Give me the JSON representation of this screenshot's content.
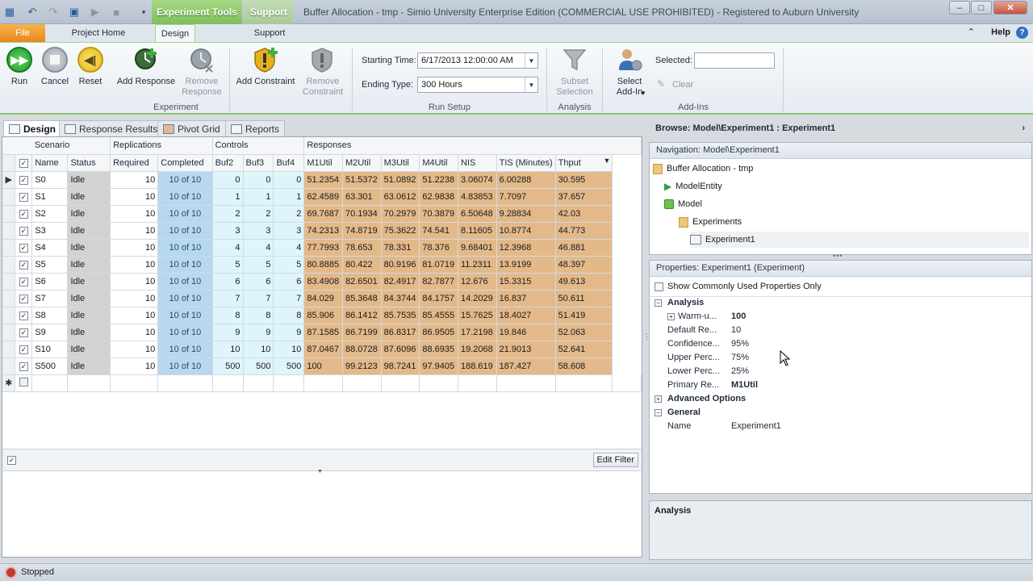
{
  "window": {
    "title": "Buffer Allocation - tmp - Simio University Enterprise Edition (COMMERCIAL USE PROHIBITED) - Registered to Auburn University",
    "context_tabs": [
      "Experiment Tools",
      "Support"
    ]
  },
  "ribbon_tabs": {
    "file": "File",
    "project_home": "Project Home",
    "design": "Design",
    "support": "Support",
    "help": "Help"
  },
  "ribbon": {
    "experiment": {
      "label": "Experiment",
      "run": "Run",
      "cancel": "Cancel",
      "reset": "Reset",
      "add_response": "Add Response",
      "remove_response": "Remove Response",
      "add_constraint": "Add Constraint",
      "remove_constraint": "Remove Constraint"
    },
    "run_setup": {
      "label": "Run Setup",
      "starting_time_label": "Starting Time:",
      "starting_time_value": "6/17/2013 12:00:00 AM",
      "ending_type_label": "Ending Type:",
      "ending_type_value": "300 Hours"
    },
    "analysis": {
      "label": "Analysis",
      "subset_selection": "Subset Selection"
    },
    "addins": {
      "label": "Add-Ins",
      "select_addin": "Select Add-In",
      "selected_label": "Selected:",
      "selected_value": "",
      "clear": "Clear"
    }
  },
  "doc_tabs": [
    "Design",
    "Response Results",
    "Pivot Grid",
    "Reports"
  ],
  "grid": {
    "bands": [
      "Scenario",
      "Replications",
      "Controls",
      "Responses"
    ],
    "columns": [
      "Name",
      "Status",
      "Required",
      "Completed",
      "Buf2",
      "Buf3",
      "Buf4",
      "M1Util",
      "M2Util",
      "M3Util",
      "M4Util",
      "NIS",
      "TIS (Minutes)",
      "Thput"
    ],
    "rows": [
      [
        "S0",
        "Idle",
        "10",
        "10 of 10",
        "0",
        "0",
        "0",
        "51.2354",
        "51.5372",
        "51.0892",
        "51.2238",
        "3.06074",
        "6.00288",
        "30.595"
      ],
      [
        "S1",
        "Idle",
        "10",
        "10 of 10",
        "1",
        "1",
        "1",
        "62.4589",
        "63.301",
        "63.0612",
        "62.9838",
        "4.83853",
        "7.7097",
        "37.657"
      ],
      [
        "S2",
        "Idle",
        "10",
        "10 of 10",
        "2",
        "2",
        "2",
        "69.7687",
        "70.1934",
        "70.2979",
        "70.3879",
        "6.50648",
        "9.28834",
        "42.03"
      ],
      [
        "S3",
        "Idle",
        "10",
        "10 of 10",
        "3",
        "3",
        "3",
        "74.2313",
        "74.8719",
        "75.3622",
        "74.541",
        "8.11605",
        "10.8774",
        "44.773"
      ],
      [
        "S4",
        "Idle",
        "10",
        "10 of 10",
        "4",
        "4",
        "4",
        "77.7993",
        "78.653",
        "78.331",
        "78.376",
        "9.68401",
        "12.3968",
        "46.881"
      ],
      [
        "S5",
        "Idle",
        "10",
        "10 of 10",
        "5",
        "5",
        "5",
        "80.8885",
        "80.422",
        "80.9196",
        "81.0719",
        "11.2311",
        "13.9199",
        "48.397"
      ],
      [
        "S6",
        "Idle",
        "10",
        "10 of 10",
        "6",
        "6",
        "6",
        "83.4908",
        "82.6501",
        "82.4917",
        "82.7877",
        "12.676",
        "15.3315",
        "49.613"
      ],
      [
        "S7",
        "Idle",
        "10",
        "10 of 10",
        "7",
        "7",
        "7",
        "84.029",
        "85.3648",
        "84.3744",
        "84.1757",
        "14.2029",
        "16.837",
        "50.611"
      ],
      [
        "S8",
        "Idle",
        "10",
        "10 of 10",
        "8",
        "8",
        "8",
        "85.906",
        "86.1412",
        "85.7535",
        "85.4555",
        "15.7625",
        "18.4027",
        "51.419"
      ],
      [
        "S9",
        "Idle",
        "10",
        "10 of 10",
        "9",
        "9",
        "9",
        "87.1585",
        "86.7199",
        "86.8317",
        "86.9505",
        "17.2198",
        "19.846",
        "52.063"
      ],
      [
        "S10",
        "Idle",
        "10",
        "10 of 10",
        "10",
        "10",
        "10",
        "87.0467",
        "88.0728",
        "87.6096",
        "88.6935",
        "19.2068",
        "21.9013",
        "52.641"
      ],
      [
        "S500",
        "Idle",
        "10",
        "10 of 10",
        "500",
        "500",
        "500",
        "100",
        "99.2123",
        "98.7241",
        "97.9405",
        "188.619",
        "187.427",
        "58.608"
      ]
    ],
    "edit_filter": "Edit Filter"
  },
  "browse": {
    "header": "Browse: Model\\Experiment1 : Experiment1",
    "navigation_title": "Navigation: Model\\Experiment1",
    "tree": [
      "Buffer Allocation - tmp",
      "ModelEntity",
      "Model",
      "Experiments",
      "Experiment1"
    ]
  },
  "properties": {
    "title": "Properties: Experiment1 (Experiment)",
    "show_common": "Show Commonly Used Properties Only",
    "categories": {
      "analysis": "Analysis",
      "advanced": "Advanced Options",
      "general": "General"
    },
    "analysis_rows": [
      {
        "name": "Warm-u...",
        "value": "100"
      },
      {
        "name": "Default Re...",
        "value": "10"
      },
      {
        "name": "Confidence...",
        "value": "95%"
      },
      {
        "name": "Upper Perc...",
        "value": "75%"
      },
      {
        "name": "Lower Perc...",
        "value": "25%"
      },
      {
        "name": "Primary Re...",
        "value": "M1Util"
      }
    ],
    "general_rows": [
      {
        "name": "Name",
        "value": "Experiment1"
      }
    ],
    "description_title": "Analysis"
  },
  "status": {
    "text": "Stopped"
  }
}
